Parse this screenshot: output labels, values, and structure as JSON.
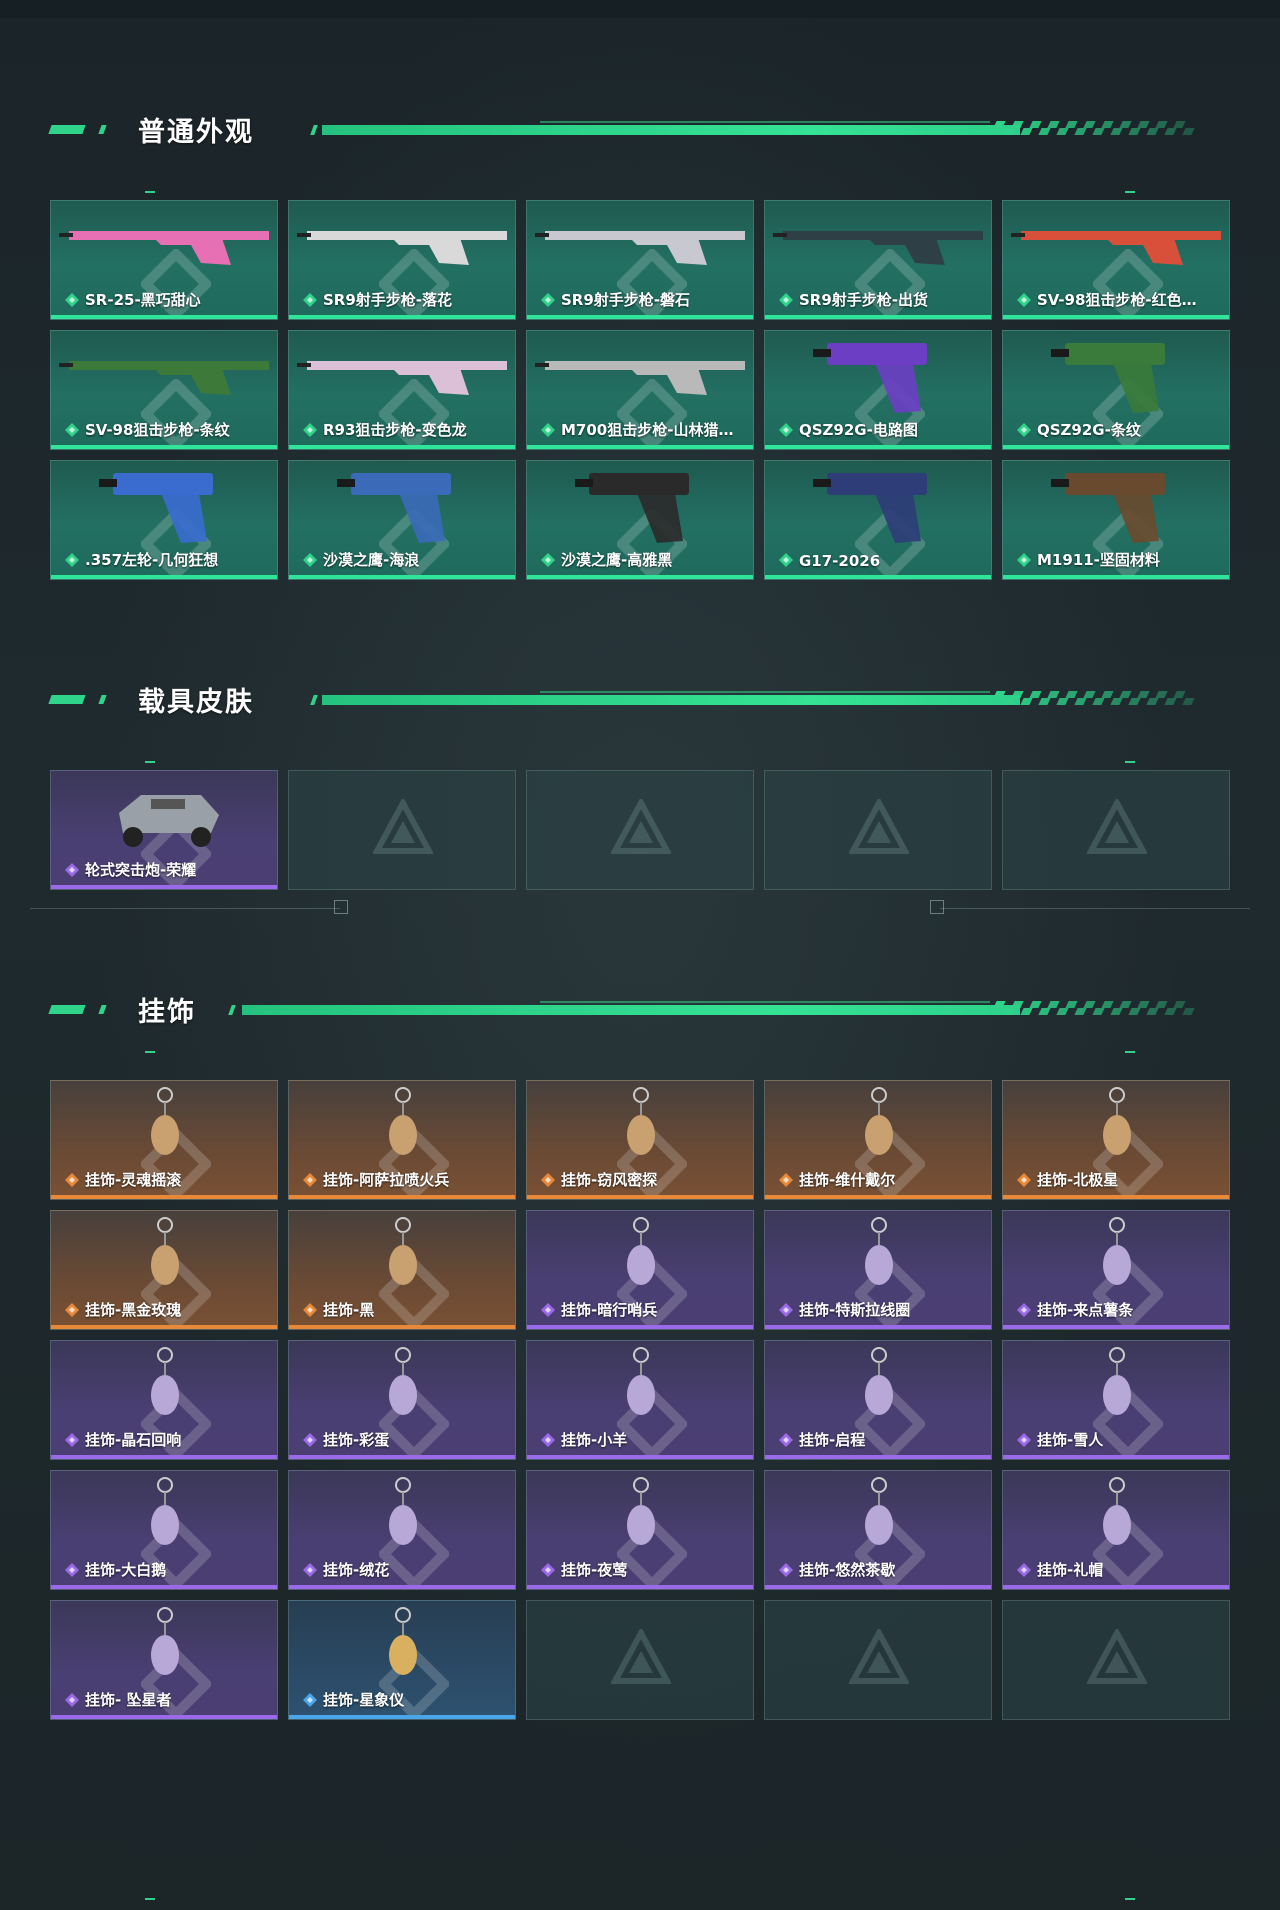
{
  "sections": {
    "normal": {
      "title": "普通外观",
      "items": [
        {
          "label": "SR-25-黑巧甜心",
          "icon": "rifle-pink-icon"
        },
        {
          "label": "SR9射手步枪-落花",
          "icon": "rifle-white-icon"
        },
        {
          "label": "SR9射手步枪-磐石",
          "icon": "rifle-camo-icon"
        },
        {
          "label": "SR9射手步枪-出货",
          "icon": "rifle-dark-icon"
        },
        {
          "label": "SV-98狙击步枪-红色…",
          "icon": "sniper-red-icon"
        },
        {
          "label": "SV-98狙击步枪-条纹",
          "icon": "sniper-green-icon"
        },
        {
          "label": "R93狙击步枪-变色龙",
          "icon": "sniper-pink-icon"
        },
        {
          "label": "M700狙击步枪-山林猎…",
          "icon": "sniper-grey-icon"
        },
        {
          "label": "QSZ92G-电路图",
          "icon": "pistol-purple-icon"
        },
        {
          "label": "QSZ92G-条纹",
          "icon": "pistol-green-icon"
        },
        {
          "label": ".357左轮-几何狂想",
          "icon": "revolver-icon"
        },
        {
          "label": "沙漠之鹰-海浪",
          "icon": "pistol-wave-icon"
        },
        {
          "label": "沙漠之鹰-高雅黑",
          "icon": "pistol-black-icon"
        },
        {
          "label": "G17-2026",
          "icon": "pistol-blue-icon"
        },
        {
          "label": "M1911-坚固材料",
          "icon": "pistol-brown-icon"
        }
      ]
    },
    "vehicle": {
      "title": "载具皮肤",
      "items": [
        {
          "label": "轮式突击炮-荣耀",
          "icon": "vehicle-icon"
        }
      ]
    },
    "charms": {
      "title": "挂饰",
      "items": [
        {
          "label": "挂饰-灵魂摇滚",
          "rarity": "orange"
        },
        {
          "label": "挂饰-阿萨拉喷火兵",
          "rarity": "orange"
        },
        {
          "label": "挂饰-窃风密探",
          "rarity": "orange"
        },
        {
          "label": "挂饰-维什戴尔",
          "rarity": "orange"
        },
        {
          "label": "挂饰-北极星",
          "rarity": "orange"
        },
        {
          "label": "挂饰-黑金玫瑰",
          "rarity": "orange"
        },
        {
          "label": "挂饰-黑",
          "rarity": "orange"
        },
        {
          "label": "挂饰-暗行哨兵",
          "rarity": "purple"
        },
        {
          "label": "挂饰-特斯拉线圈",
          "rarity": "purple"
        },
        {
          "label": "挂饰-来点薯条",
          "rarity": "purple"
        },
        {
          "label": "挂饰-晶石回响",
          "rarity": "purple"
        },
        {
          "label": "挂饰-彩蛋",
          "rarity": "purple"
        },
        {
          "label": "挂饰-小羊",
          "rarity": "purple"
        },
        {
          "label": "挂饰-启程",
          "rarity": "purple"
        },
        {
          "label": "挂饰-雪人",
          "rarity": "purple"
        },
        {
          "label": "挂饰-大白鹅",
          "rarity": "purple"
        },
        {
          "label": "挂饰-绒花",
          "rarity": "purple"
        },
        {
          "label": "挂饰-夜莺",
          "rarity": "purple"
        },
        {
          "label": "挂饰-悠然茶歇",
          "rarity": "purple"
        },
        {
          "label": "挂饰-礼帽",
          "rarity": "purple"
        },
        {
          "label": "挂饰- 坠星者",
          "rarity": "purple"
        },
        {
          "label": "挂饰-星象仪",
          "rarity": "blue"
        }
      ]
    }
  },
  "colors": {
    "accent_green": "#2fd48a",
    "rarity_purple": "#9a6ae8",
    "rarity_orange": "#e8893a",
    "rarity_blue": "#4aa6e8"
  }
}
